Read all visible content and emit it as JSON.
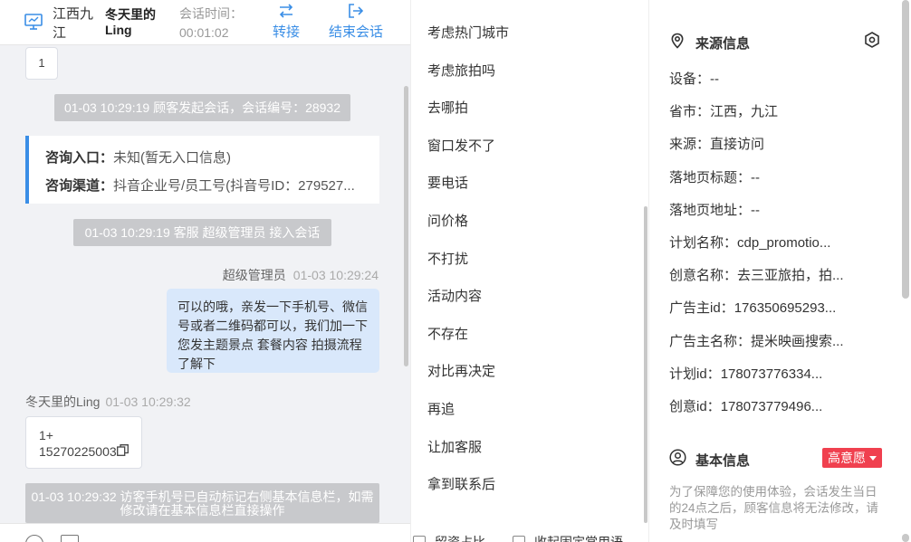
{
  "header": {
    "city": "江西九江",
    "visitor_name": "冬天里的Ling",
    "session_time_label": "会话时间：",
    "session_time_value": "00:01:02",
    "transfer_label": "转接",
    "end_label": "结束会话",
    "transfer_icon": "swap-icon",
    "end_icon": "logout-icon"
  },
  "chat": {
    "first_card_text": "1",
    "system_messages": [
      "01-03 10:29:19 顾客发起会话，会话编号：28932",
      "01-03 10:29:19 客服 超级管理员 接入会话",
      "01-03 10:29:32 访客手机号已自动标记右侧基本信息栏，如需修改请在基本信息栏直接操作"
    ],
    "entry": {
      "label1": "咨询入口：",
      "value1": "未知(暂无入口信息)",
      "label2": "咨询渠道：",
      "value2": "抖音企业号/员工号(抖音号ID：279527..."
    },
    "agent": {
      "name": "超级管理员",
      "time": "01-03 10:29:24",
      "message": "可以的哦，亲发一下手机号、微信号或者二维码都可以，我们加一下您发主题景点 套餐内容 拍摄流程了解下"
    },
    "customer": {
      "name": "冬天里的Ling",
      "time": "01-03 10:29:32",
      "line1": "1+",
      "line2": "15270225003"
    }
  },
  "quick_replies": [
    "考虑热门城市",
    "考虑旅拍吗",
    "去哪拍",
    "窗口发不了",
    "要电话",
    "问价格",
    "不打扰",
    "活动内容",
    "不存在",
    "对比再决定",
    "再追",
    "让加客服",
    "拿到联系后"
  ],
  "quick_footer": {
    "option1": "留资占比",
    "option2": "收起固定常用语"
  },
  "source_info": {
    "title": "来源信息",
    "fields": [
      {
        "label": "设备：",
        "value": "--"
      },
      {
        "label": "省市：",
        "value": "江西，九江"
      },
      {
        "label": "来源：",
        "value": "直接访问"
      },
      {
        "label": "落地页标题：",
        "value": "--"
      },
      {
        "label": "落地页地址：",
        "value": "--"
      },
      {
        "label": "计划名称：",
        "value": "cdp_promotio..."
      },
      {
        "label": "创意名称：",
        "value": "去三亚旅拍，拍..."
      },
      {
        "label": "广告主id：",
        "value": "176350695293..."
      },
      {
        "label": "广告主名称：",
        "value": "提米映画搜索..."
      },
      {
        "label": "计划id：",
        "value": "178073776334..."
      },
      {
        "label": "创意id：",
        "value": "178073779496..."
      }
    ]
  },
  "basic_info": {
    "title": "基本信息",
    "intent_badge": "高意愿",
    "intent_color": "#f0404f",
    "notice": "为了保障您的使用体验，会话发生当日的24点之后，顾客信息将无法修改，请及时填写"
  },
  "colors": {
    "accent": "#3a8ee6",
    "agent_bubble": "#d9e8fb",
    "system_bg": "#c8c9cc"
  }
}
